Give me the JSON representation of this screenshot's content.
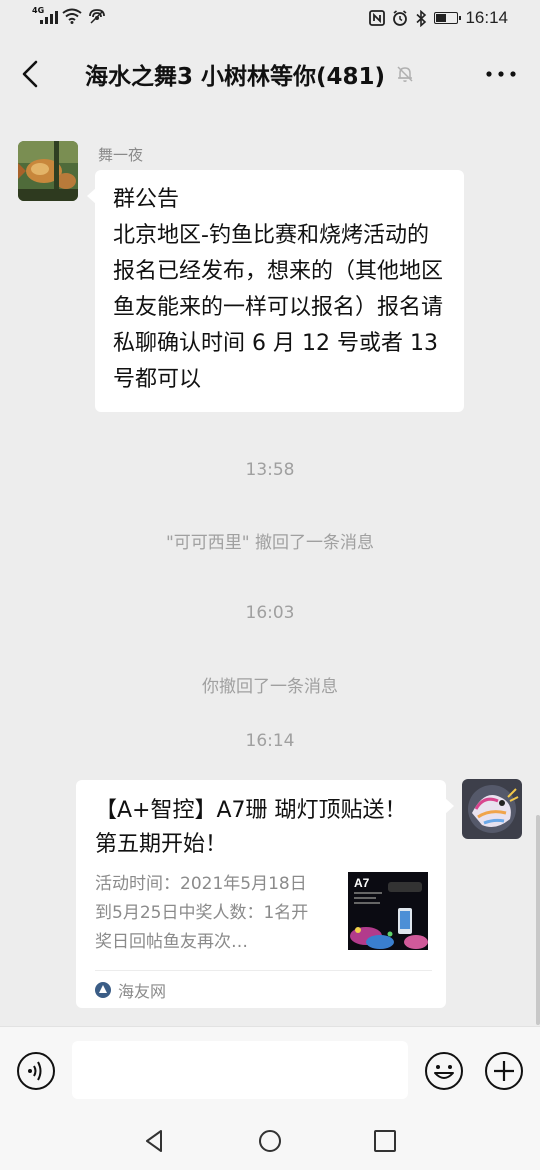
{
  "status_bar": {
    "network": "4G",
    "time": "16:14"
  },
  "header": {
    "title": "海水之舞3 小树林等你(481)"
  },
  "messages": {
    "announcement": {
      "sender": "舞一夜",
      "heading": "群公告",
      "body": "北京地区-钓鱼比赛和烧烤活动的报名已经发布，想来的（其他地区鱼友能来的一样可以报名）报名请私聊确认时间 6 月 12 号或者 13 号都可以"
    },
    "time_1": "13:58",
    "recall_1": "\"可可西里\" 撤回了一条消息",
    "time_2": "16:03",
    "recall_2": "你撤回了一条消息",
    "time_3": "16:14",
    "link_card": {
      "title": "【A+智控】A7珊 瑚灯顶贴送！第五期开始！",
      "description": "活动时间：2021年5月18日到5月25日中奖人数：1名开奖日回帖鱼友再次…",
      "thumb_text": "A7",
      "source": "海友网"
    }
  },
  "input": {
    "placeholder": ""
  },
  "colors": {
    "background": "#ededed",
    "bubble": "#ffffff",
    "system_text": "#a0a0a0"
  }
}
